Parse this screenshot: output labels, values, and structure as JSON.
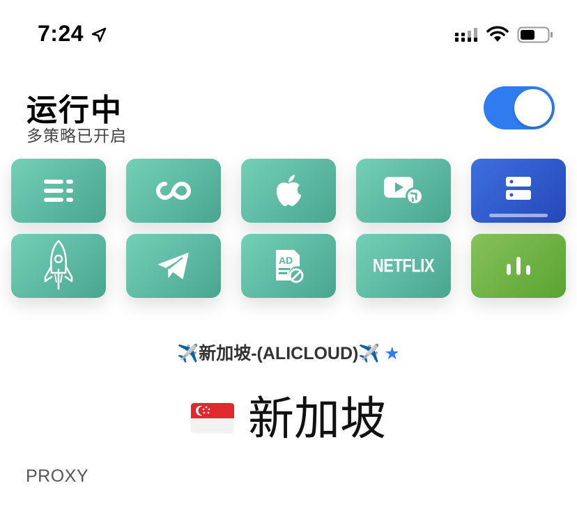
{
  "status_bar": {
    "time": "7:24",
    "icons": [
      "location-arrow-icon",
      "cellular-signal-icon",
      "wifi-icon",
      "battery-icon"
    ]
  },
  "header": {
    "title": "运行中",
    "subtitle": "多策略已开启",
    "toggle_on": true,
    "accent_color": "#2f7bf0"
  },
  "tiles": [
    {
      "name": "list-rules",
      "icon": "list-icon",
      "active": false
    },
    {
      "name": "infinity-policy",
      "icon": "infinity-icon",
      "active": false
    },
    {
      "name": "apple-policy",
      "icon": "apple-icon",
      "active": false
    },
    {
      "name": "streaming-policy",
      "icon": "video-globe-icon",
      "active": false
    },
    {
      "name": "server-policy",
      "icon": "server-icon",
      "active": true
    },
    {
      "name": "rocket-policy",
      "icon": "rocket-icon",
      "active": false
    },
    {
      "name": "telegram-policy",
      "icon": "telegram-icon",
      "active": false
    },
    {
      "name": "ad-block-policy",
      "icon": "ad-block-icon",
      "active": false
    },
    {
      "name": "netflix-policy",
      "icon": "netflix-logo",
      "label": "NETFLIX",
      "active": false
    },
    {
      "name": "stats-policy",
      "icon": "bar-chart-icon",
      "active": false
    }
  ],
  "policy": {
    "label": "✈️新加坡-(ALICLOUD)✈️",
    "star": "★"
  },
  "server": {
    "flag": "singapore-flag",
    "name": "新加坡"
  },
  "section": {
    "label": "PROXY"
  }
}
